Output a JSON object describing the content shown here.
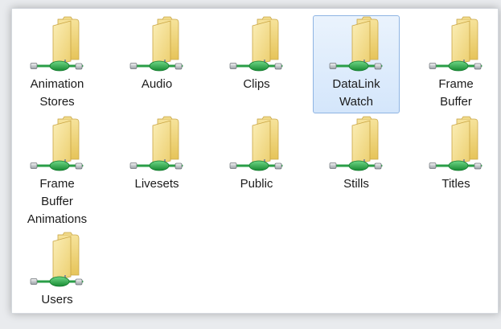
{
  "items": [
    {
      "label": "Animation\nStores",
      "icon": "network-folder-icon"
    },
    {
      "label": "Audio",
      "icon": "network-folder-icon"
    },
    {
      "label": "Clips",
      "icon": "network-folder-icon"
    },
    {
      "label": "DataLink\nWatch",
      "icon": "network-folder-icon",
      "selected": true
    },
    {
      "label": "Frame\nBuffer",
      "icon": "network-folder-icon"
    },
    {
      "label": "Frame\nBuffer\nAnimations",
      "icon": "network-folder-icon"
    },
    {
      "label": "Livesets",
      "icon": "network-folder-icon"
    },
    {
      "label": "Public",
      "icon": "network-folder-icon"
    },
    {
      "label": "Stills",
      "icon": "network-folder-icon"
    },
    {
      "label": "Titles",
      "icon": "network-folder-icon"
    },
    {
      "label": "Users",
      "icon": "network-folder-icon"
    }
  ],
  "colors": {
    "folder": "#f2d574",
    "cable": "#1f9a3c",
    "selection": "#d4e6fb"
  }
}
